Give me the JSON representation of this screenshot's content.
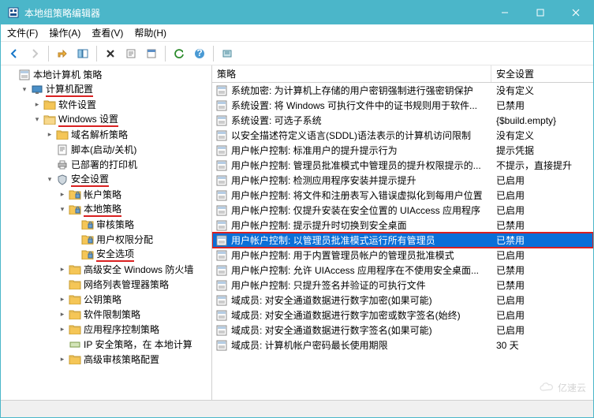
{
  "window": {
    "title": "本地组策略编辑器"
  },
  "menu": {
    "file": "文件(F)",
    "action": "操作(A)",
    "view": "查看(V)",
    "help": "帮助(H)"
  },
  "toolbar": {
    "back": "back",
    "forward": "forward",
    "up": "up",
    "show": "show",
    "delete": "delete",
    "export": "export",
    "properties": "properties",
    "refresh": "refresh",
    "help": "help",
    "filter": "filter"
  },
  "tree": {
    "root": "本地计算机 策略",
    "computer_config": "计算机配置",
    "software": "软件设置",
    "windows_settings": "Windows 设置",
    "dns_policy": "域名解析策略",
    "scripts": "脚本(启动/关机)",
    "deployed_printers": "已部署的打印机",
    "security": "安全设置",
    "account_policy": "帐户策略",
    "local_policy": "本地策略",
    "audit": "审核策略",
    "user_rights": "用户权限分配",
    "security_options": "安全选项",
    "advanced_firewall": "高级安全 Windows 防火墙",
    "net_list": "网络列表管理器策略",
    "public_key": "公钥策略",
    "software_restrict": "软件限制策略",
    "app_control": "应用程序控制策略",
    "ip_security": "IP 安全策略，在 本地计算",
    "advanced_audit": "高级审核策略配置"
  },
  "list": {
    "col_policy": "策略",
    "col_setting": "安全设置",
    "rows": [
      {
        "policy": "系统加密: 为计算机上存储的用户密钥强制进行强密钥保护",
        "setting": "没有定义"
      },
      {
        "policy": "系统设置: 将 Windows 可执行文件中的证书规则用于软件...",
        "setting": "已禁用"
      },
      {
        "policy": "系统设置: 可选子系统",
        "setting": "{$build.empty}"
      },
      {
        "policy": "以安全描述符定义语言(SDDL)语法表示的计算机访问限制",
        "setting": "没有定义"
      },
      {
        "policy": "用户帐户控制: 标准用户的提升提示行为",
        "setting": "提示凭据"
      },
      {
        "policy": "用户帐户控制: 管理员批准模式中管理员的提升权限提示的...",
        "setting": "不提示，直接提升"
      },
      {
        "policy": "用户帐户控制: 检测应用程序安装并提示提升",
        "setting": "已启用"
      },
      {
        "policy": "用户帐户控制: 将文件和注册表写入错误虚拟化到每用户位置",
        "setting": "已启用"
      },
      {
        "policy": "用户帐户控制: 仅提升安装在安全位置的 UIAccess 应用程序",
        "setting": "已启用"
      },
      {
        "policy": "用户帐户控制: 提示提升时切换到安全桌面",
        "setting": "已禁用"
      },
      {
        "policy": "用户帐户控制: 以管理员批准模式运行所有管理员",
        "setting": "已禁用",
        "selected": true
      },
      {
        "policy": "用户帐户控制: 用于内置管理员帐户的管理员批准模式",
        "setting": "已启用"
      },
      {
        "policy": "用户帐户控制: 允许 UIAccess 应用程序在不使用安全桌面...",
        "setting": "已禁用"
      },
      {
        "policy": "用户帐户控制: 只提升签名并验证的可执行文件",
        "setting": "已禁用"
      },
      {
        "policy": "域成员: 对安全通道数据进行数字加密(如果可能)",
        "setting": "已启用"
      },
      {
        "policy": "域成员: 对安全通道数据进行数字加密或数字签名(始终)",
        "setting": "已启用"
      },
      {
        "policy": "域成员: 对安全通道数据进行数字签名(如果可能)",
        "setting": "已启用"
      },
      {
        "policy": "域成员: 计算机帐户密码最长使用期限",
        "setting": "30 天"
      }
    ]
  },
  "watermark": "亿速云"
}
